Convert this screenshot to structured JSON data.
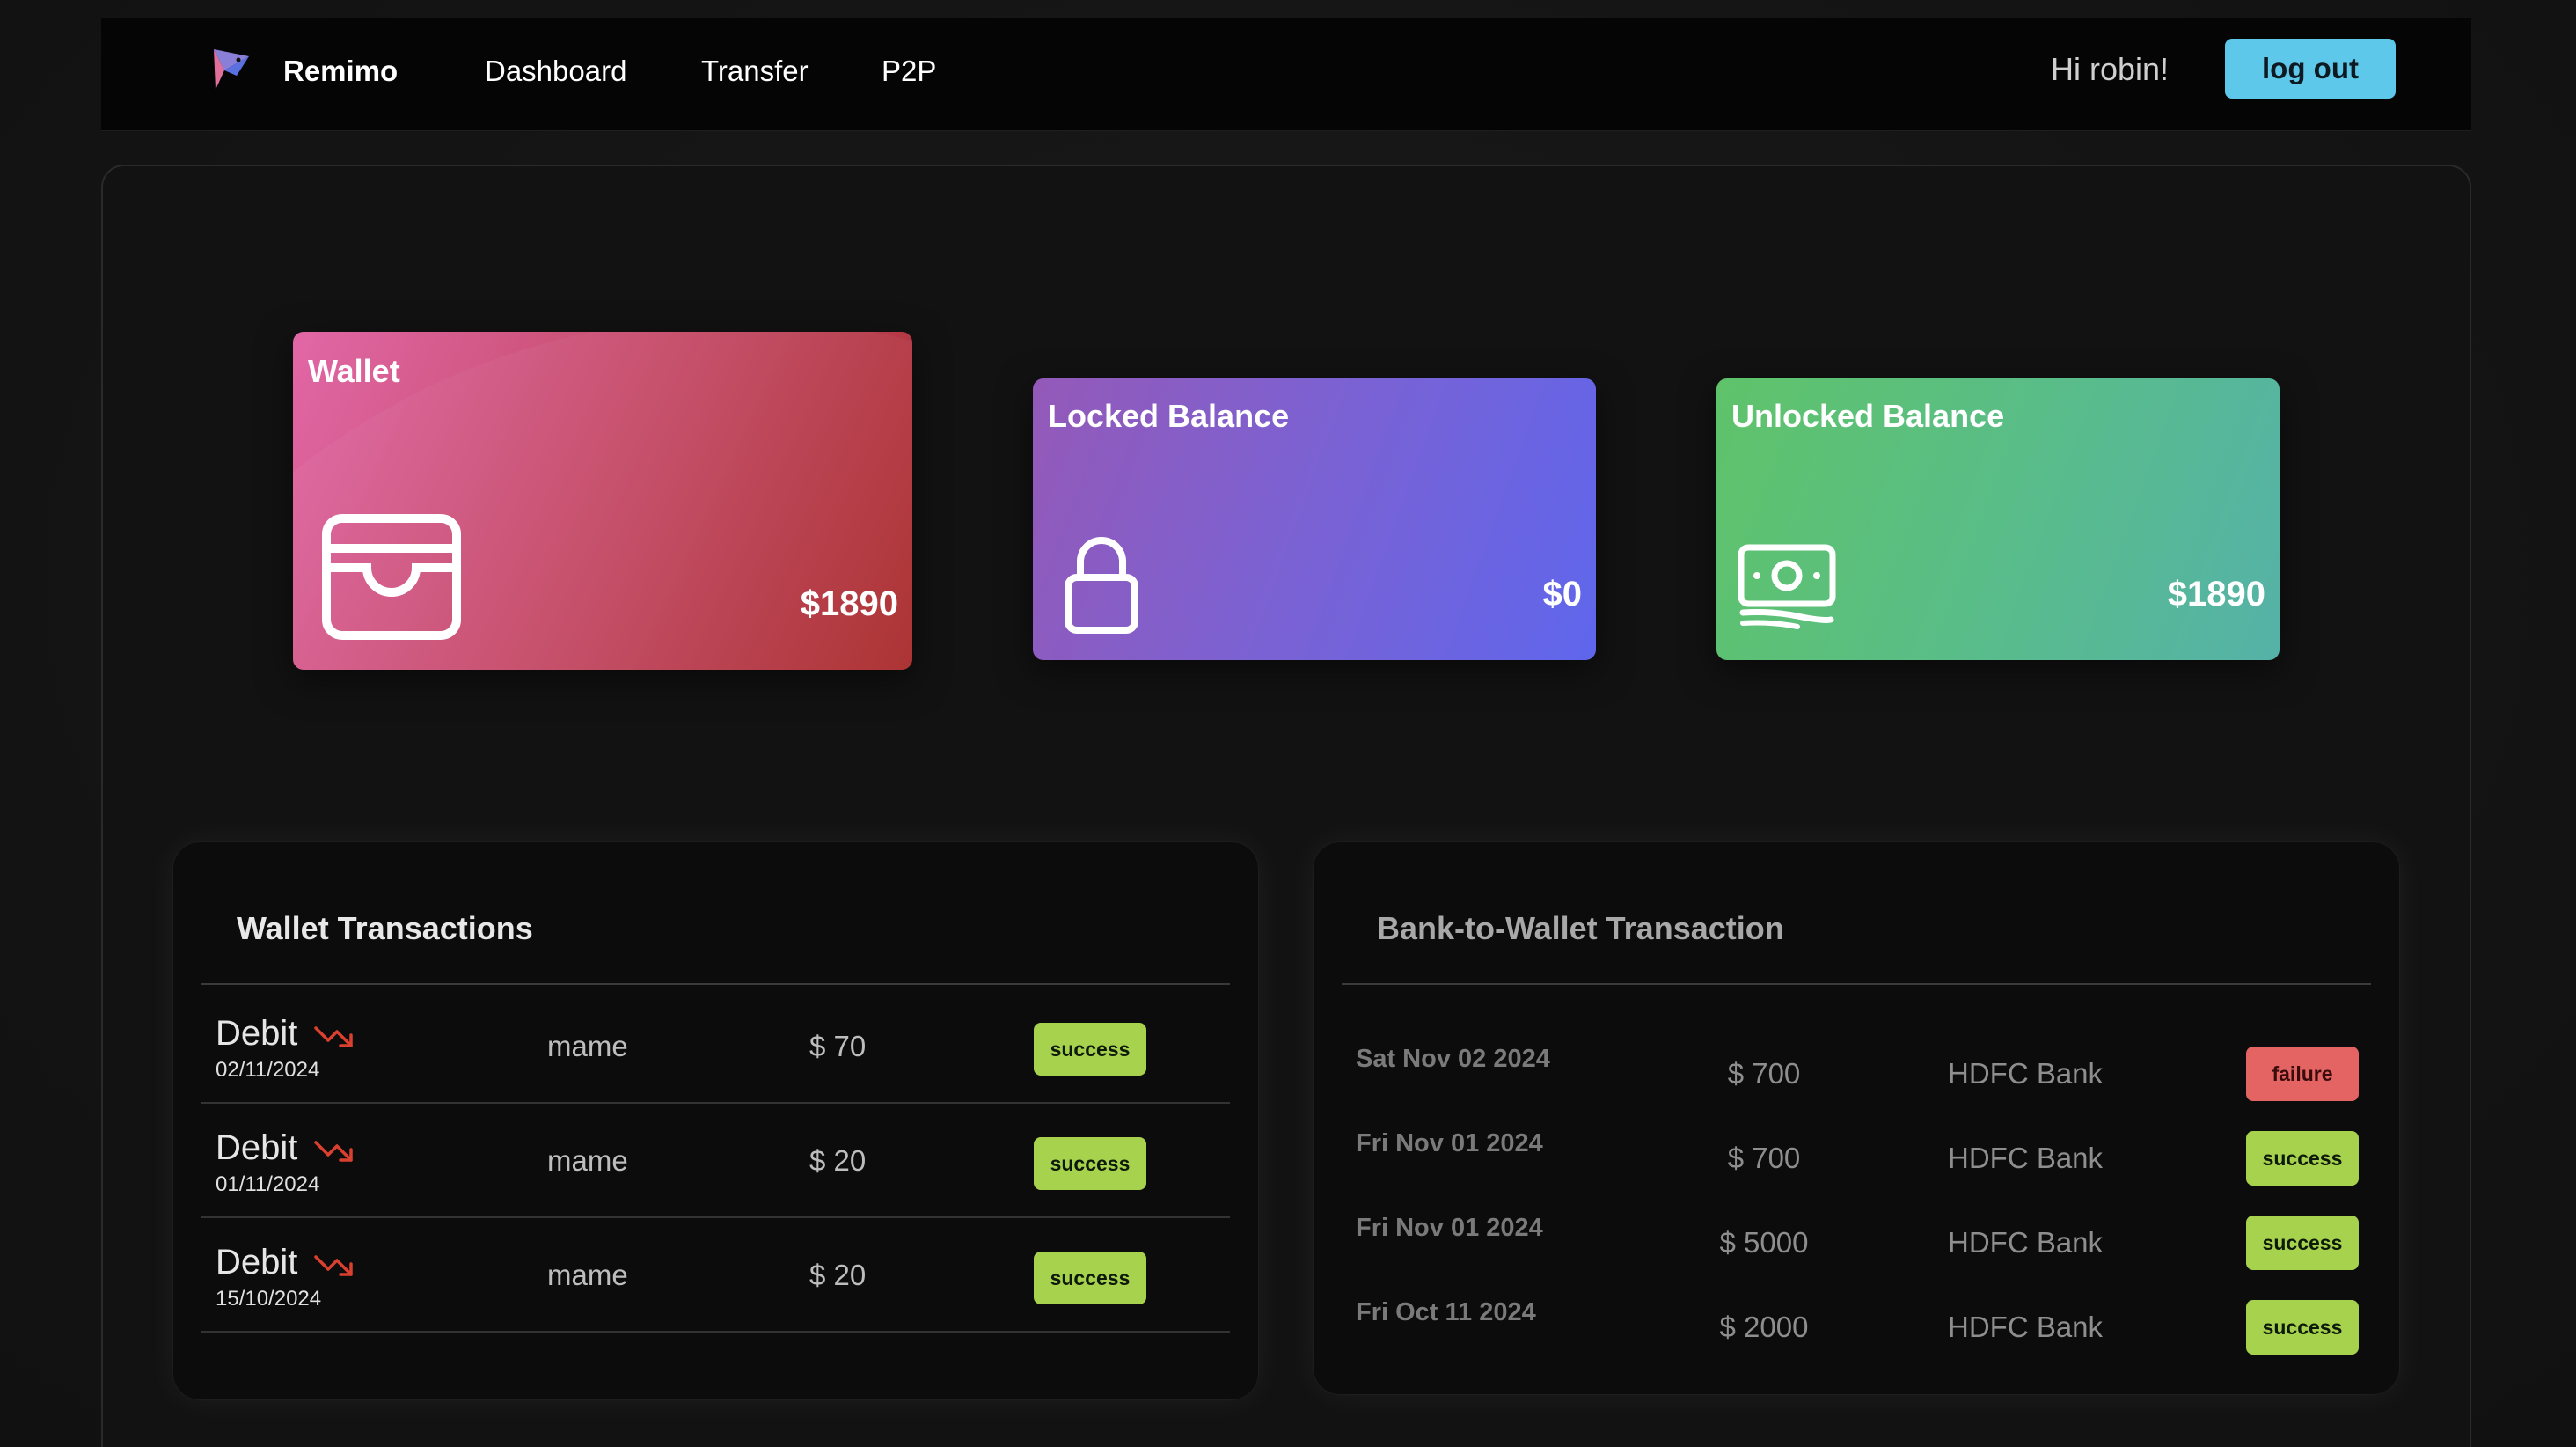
{
  "navbar": {
    "brand": "Remimo",
    "links": [
      "Dashboard",
      "Transfer",
      "P2P"
    ],
    "greeting": "Hi robin!",
    "logout_label": "log out"
  },
  "cards": {
    "wallet": {
      "title": "Wallet",
      "amount": "$1890",
      "icon": "wallet-icon"
    },
    "locked": {
      "title": "Locked Balance",
      "amount": "$0",
      "icon": "lock-icon"
    },
    "unlocked": {
      "title": "Unlocked Balance",
      "amount": "$1890",
      "icon": "cash-icon"
    }
  },
  "wallet_transactions": {
    "title": "Wallet Transactions",
    "rows": [
      {
        "type": "Debit",
        "date": "02/11/2024",
        "name": "mame",
        "amount": "$ 70",
        "status": "success"
      },
      {
        "type": "Debit",
        "date": "01/11/2024",
        "name": "mame",
        "amount": "$ 20",
        "status": "success"
      },
      {
        "type": "Debit",
        "date": "15/10/2024",
        "name": "mame",
        "amount": "$ 20",
        "status": "success"
      }
    ]
  },
  "bank_transactions": {
    "title": "Bank-to-Wallet Transaction",
    "rows": [
      {
        "date": "Sat Nov 02 2024",
        "amount": "$ 700",
        "bank": "HDFC Bank",
        "status": "failure"
      },
      {
        "date": "Fri Nov 01 2024",
        "amount": "$ 700",
        "bank": "HDFC Bank",
        "status": "success"
      },
      {
        "date": "Fri Nov 01 2024",
        "amount": "$ 5000",
        "bank": "HDFC Bank",
        "status": "success"
      },
      {
        "date": "Fri Oct 11 2024",
        "amount": "$ 2000",
        "bank": "HDFC Bank",
        "status": "success"
      }
    ]
  },
  "colors": {
    "accent": "#5ec8ea",
    "success": "#a7d24e",
    "failure": "#e46363",
    "debit_trend": "#d9402f"
  }
}
